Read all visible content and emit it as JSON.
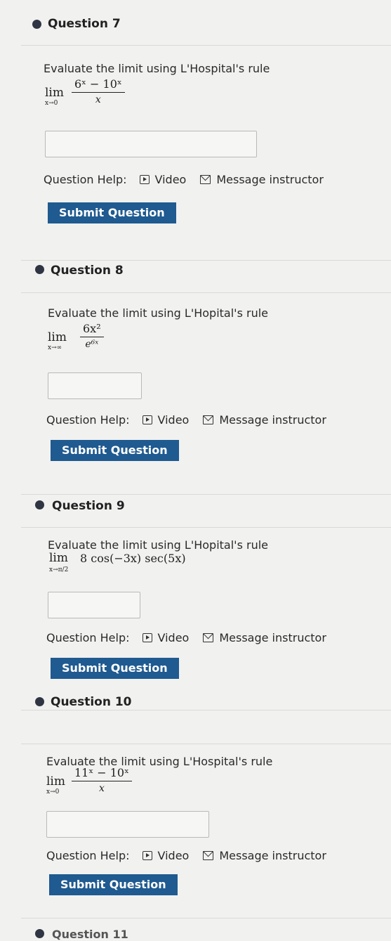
{
  "help_label": "Question Help:",
  "video_label": "Video",
  "message_label": "Message instructor",
  "submit_label": "Submit Question",
  "questions": [
    {
      "title": "Question 7",
      "prompt": "Evaluate the limit using L'Hospital's rule",
      "lim": "lim",
      "approach": "x→0",
      "numerator": "6ˣ − 10ˣ",
      "denominator": "x",
      "answer": ""
    },
    {
      "title": "Question 8",
      "prompt": "Evaluate the limit using L'Hopital's rule",
      "lim": "lim",
      "approach": "x→∞",
      "numerator": "6x²",
      "denominator": "e⁶ˣ",
      "answer": ""
    },
    {
      "title": "Question 9",
      "prompt": "Evaluate the limit using L'Hopital's rule",
      "lim": "lim",
      "approach": "x→π/2",
      "expression": "8 cos(−3x) sec(5x)",
      "answer": ""
    },
    {
      "title": "Question 10",
      "prompt": "Evaluate the limit using L'Hospital's rule",
      "lim": "lim",
      "approach": "x→0",
      "numerator": "11ˣ − 10ˣ",
      "denominator": "x",
      "answer": ""
    }
  ],
  "next_question_partial": "Question 11"
}
